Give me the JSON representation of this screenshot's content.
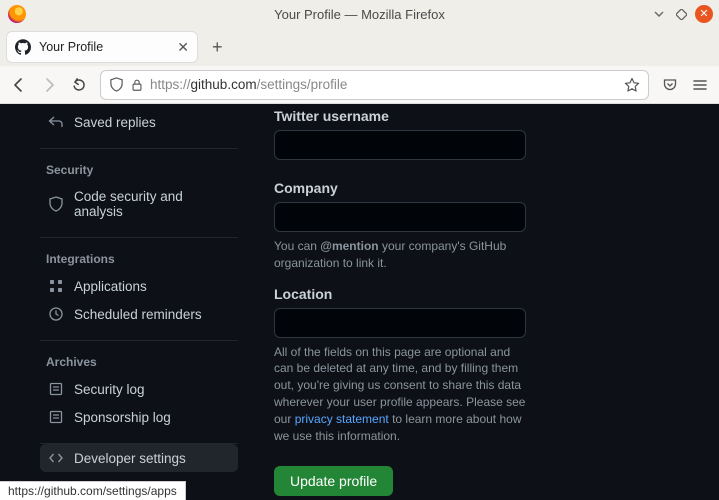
{
  "window": {
    "title": "Your Profile — Mozilla Firefox"
  },
  "tab": {
    "title": "Your Profile"
  },
  "addressbar": {
    "protocol": "https://",
    "host": "github.com",
    "path": "/settings/profile"
  },
  "sidebar": {
    "items_top": [
      {
        "label": "Saved replies"
      }
    ],
    "sections": [
      {
        "title": "Security",
        "items": [
          {
            "label": "Code security and analysis"
          }
        ]
      },
      {
        "title": "Integrations",
        "items": [
          {
            "label": "Applications"
          },
          {
            "label": "Scheduled reminders"
          }
        ]
      },
      {
        "title": "Archives",
        "items": [
          {
            "label": "Security log"
          },
          {
            "label": "Sponsorship log"
          }
        ]
      }
    ],
    "developer_settings": "Developer settings"
  },
  "form": {
    "twitter_label": "Twitter username",
    "company_label": "Company",
    "company_help_pre": "You can ",
    "company_help_bold": "@mention",
    "company_help_post": " your company's GitHub organization to link it.",
    "location_label": "Location",
    "disclaimer_pre": "All of the fields on this page are optional and can be deleted at any time, and by filling them out, you're giving us consent to share this data wherever your user profile appears. Please see our ",
    "disclaimer_link": "privacy statement",
    "disclaimer_post": " to learn more about how we use this information.",
    "submit": "Update profile"
  },
  "statusbar": "https://github.com/settings/apps"
}
